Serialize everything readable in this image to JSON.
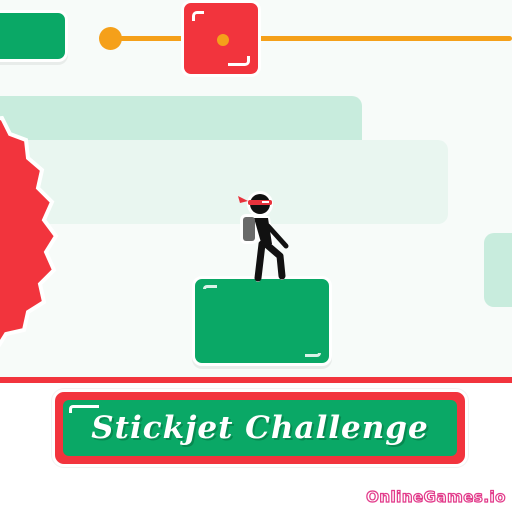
{
  "game": {
    "title": "Stickjet Challenge",
    "watermark": "OnlineGames.io"
  },
  "colors": {
    "accent_green": "#0aa866",
    "hazard_red": "#f2343d",
    "track_orange": "#f5a01a",
    "pale_mint": "#c8ecdd",
    "watermark_pink": "#e23a8a"
  },
  "icons": {
    "player": "stickman-ninja-icon",
    "hazard": "red-spiked-saw-icon",
    "moving_block": "red-moving-block-icon"
  }
}
